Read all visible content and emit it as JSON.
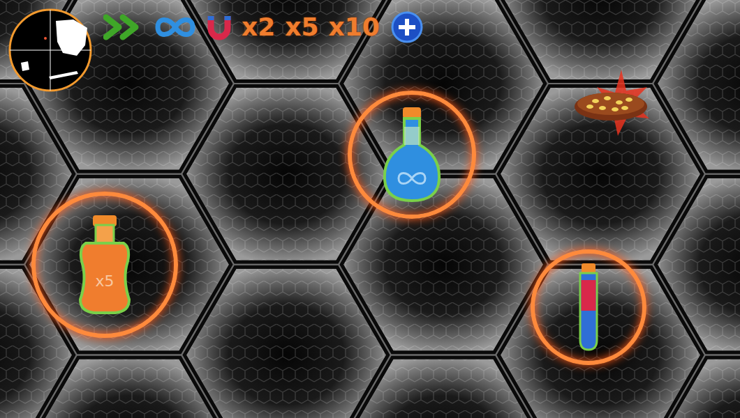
{
  "hud": {
    "items": [
      {
        "kind": "speed"
      },
      {
        "kind": "infinite"
      },
      {
        "kind": "magnet"
      },
      {
        "kind": "multiplier",
        "label": "x2"
      },
      {
        "kind": "multiplier",
        "label": "x5"
      },
      {
        "kind": "multiplier",
        "label": "x10"
      },
      {
        "kind": "plus"
      }
    ]
  },
  "pickups": [
    {
      "kind": "bottle",
      "label": "x5"
    },
    {
      "kind": "flask"
    },
    {
      "kind": "tube"
    },
    {
      "kind": "pizza"
    }
  ]
}
